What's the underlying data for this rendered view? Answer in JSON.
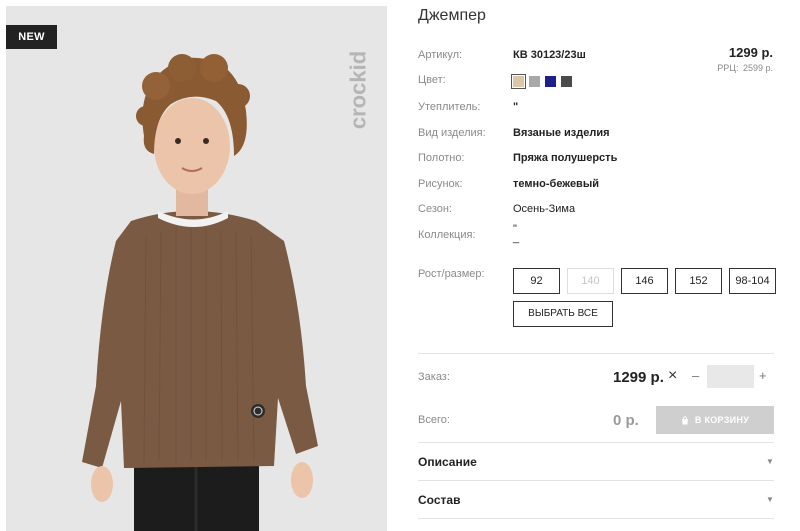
{
  "product": {
    "badge": "NEW",
    "brand_logo_text": "crockid",
    "title": "Джемпер",
    "price": "1299 р.",
    "rrp_label": "РРЦ:",
    "rrp_value": "2599 р."
  },
  "attributes": {
    "article": {
      "label": "Артикул:",
      "value": "КВ 30123/23ш"
    },
    "color": {
      "label": "Цвет:"
    },
    "insulation": {
      "label": "Утеплитель:",
      "value": "\""
    },
    "item_type": {
      "label": "Вид изделия:",
      "value": "Вязаные изделия"
    },
    "fabric": {
      "label": "Полотно:",
      "value": "Пряжа полушерсть"
    },
    "pattern": {
      "label": "Рисунок:",
      "value": "темно-бежевый"
    },
    "season": {
      "label": "Сезон:",
      "value": "Осень-Зима"
    },
    "collection": {
      "label": "Коллекция:",
      "value": "\"\n_"
    }
  },
  "swatches": [
    {
      "color": "#d9c7a7",
      "selected": true
    },
    {
      "color": "#a8a8a8",
      "selected": false
    },
    {
      "color": "#1f1f8a",
      "selected": false
    },
    {
      "color": "#4a4a4a",
      "selected": false
    }
  ],
  "sizes": {
    "label": "Рост/размер:",
    "options": [
      {
        "label": "92",
        "disabled": false
      },
      {
        "label": "140",
        "disabled": true
      },
      {
        "label": "146",
        "disabled": false
      },
      {
        "label": "152",
        "disabled": false
      },
      {
        "label": "98-104",
        "disabled": false
      }
    ],
    "select_all": "ВЫБРАТЬ ВСЕ"
  },
  "order": {
    "label": "Заказ:",
    "price": "1299 р.",
    "times": "×",
    "minus": "–",
    "plus": "+",
    "quantity": ""
  },
  "total": {
    "label": "Всего:",
    "value": "0 р.",
    "cart_button": "В КОРЗИНУ"
  },
  "sections": {
    "description": "Описание",
    "composition": "Состав",
    "chevron": "▼"
  },
  "colors": {
    "sweater": "#7a5a43",
    "cart_button_bg": "#cfcfcf",
    "photo_bg": "#e7e6e6"
  }
}
